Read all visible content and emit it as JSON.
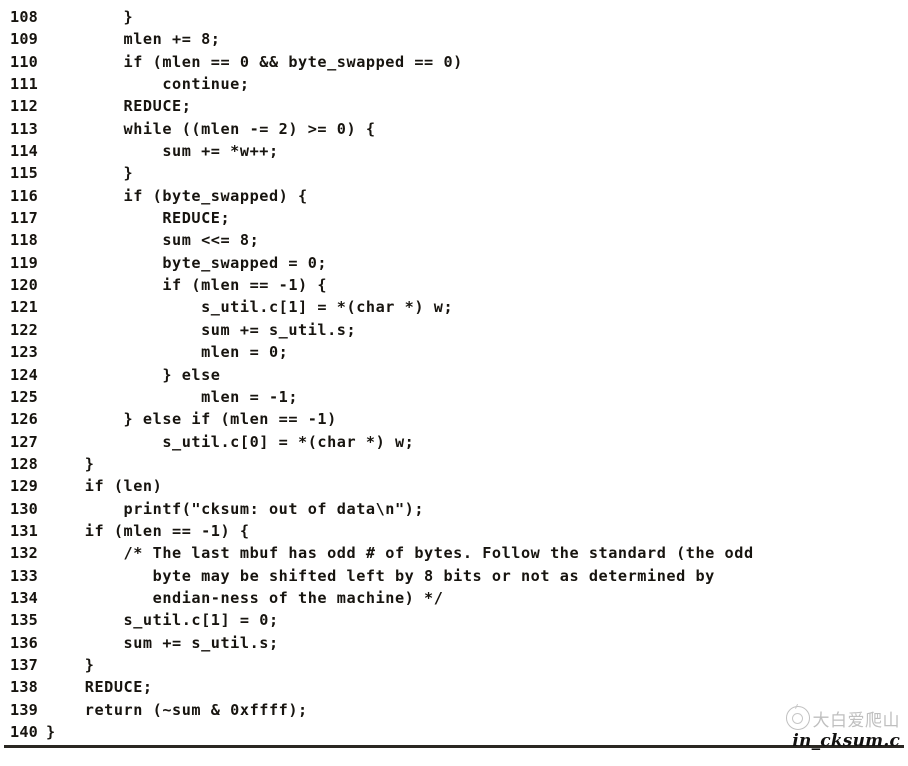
{
  "page": {
    "kind": "scanned-code-listing",
    "file_caption": "in_cksum.c",
    "ink_color": "#17140f",
    "paper_color": "#ffffff",
    "rule_color": "#2a2722"
  },
  "watermark": {
    "logo_icon": "wechat-circle-logo-icon",
    "text": "大白爱爬山",
    "color": "#8b8b8b"
  },
  "listing": {
    "first_line_number": 108,
    "last_line_number": 140,
    "lines": [
      {
        "no": "108",
        "code": "        }"
      },
      {
        "no": "109",
        "code": "        mlen += 8;"
      },
      {
        "no": "110",
        "code": "        if (mlen == 0 && byte_swapped == 0)"
      },
      {
        "no": "111",
        "code": "            continue;"
      },
      {
        "no": "112",
        "code": "        REDUCE;"
      },
      {
        "no": "113",
        "code": "        while ((mlen -= 2) >= 0) {"
      },
      {
        "no": "114",
        "code": "            sum += *w++;"
      },
      {
        "no": "115",
        "code": "        }"
      },
      {
        "no": "116",
        "code": "        if (byte_swapped) {"
      },
      {
        "no": "117",
        "code": "            REDUCE;"
      },
      {
        "no": "118",
        "code": "            sum <<= 8;"
      },
      {
        "no": "119",
        "code": "            byte_swapped = 0;"
      },
      {
        "no": "120",
        "code": "            if (mlen == -1) {"
      },
      {
        "no": "121",
        "code": "                s_util.c[1] = *(char *) w;"
      },
      {
        "no": "122",
        "code": "                sum += s_util.s;"
      },
      {
        "no": "123",
        "code": "                mlen = 0;"
      },
      {
        "no": "124",
        "code": "            } else"
      },
      {
        "no": "125",
        "code": "                mlen = -1;"
      },
      {
        "no": "126",
        "code": "        } else if (mlen == -1)"
      },
      {
        "no": "127",
        "code": "            s_util.c[0] = *(char *) w;"
      },
      {
        "no": "128",
        "code": "    }"
      },
      {
        "no": "129",
        "code": "    if (len)"
      },
      {
        "no": "130",
        "code": "        printf(\"cksum: out of data\\n\");"
      },
      {
        "no": "131",
        "code": "    if (mlen == -1) {"
      },
      {
        "no": "132",
        "code": "        /* The last mbuf has odd # of bytes. Follow the standard (the odd"
      },
      {
        "no": "133",
        "code": "           byte may be shifted left by 8 bits or not as determined by"
      },
      {
        "no": "134",
        "code": "           endian-ness of the machine) */"
      },
      {
        "no": "135",
        "code": "        s_util.c[1] = 0;"
      },
      {
        "no": "136",
        "code": "        sum += s_util.s;"
      },
      {
        "no": "137",
        "code": "    }"
      },
      {
        "no": "138",
        "code": "    REDUCE;"
      },
      {
        "no": "139",
        "code": "    return (~sum & 0xffff);"
      },
      {
        "no": "140",
        "code": "}"
      }
    ]
  }
}
